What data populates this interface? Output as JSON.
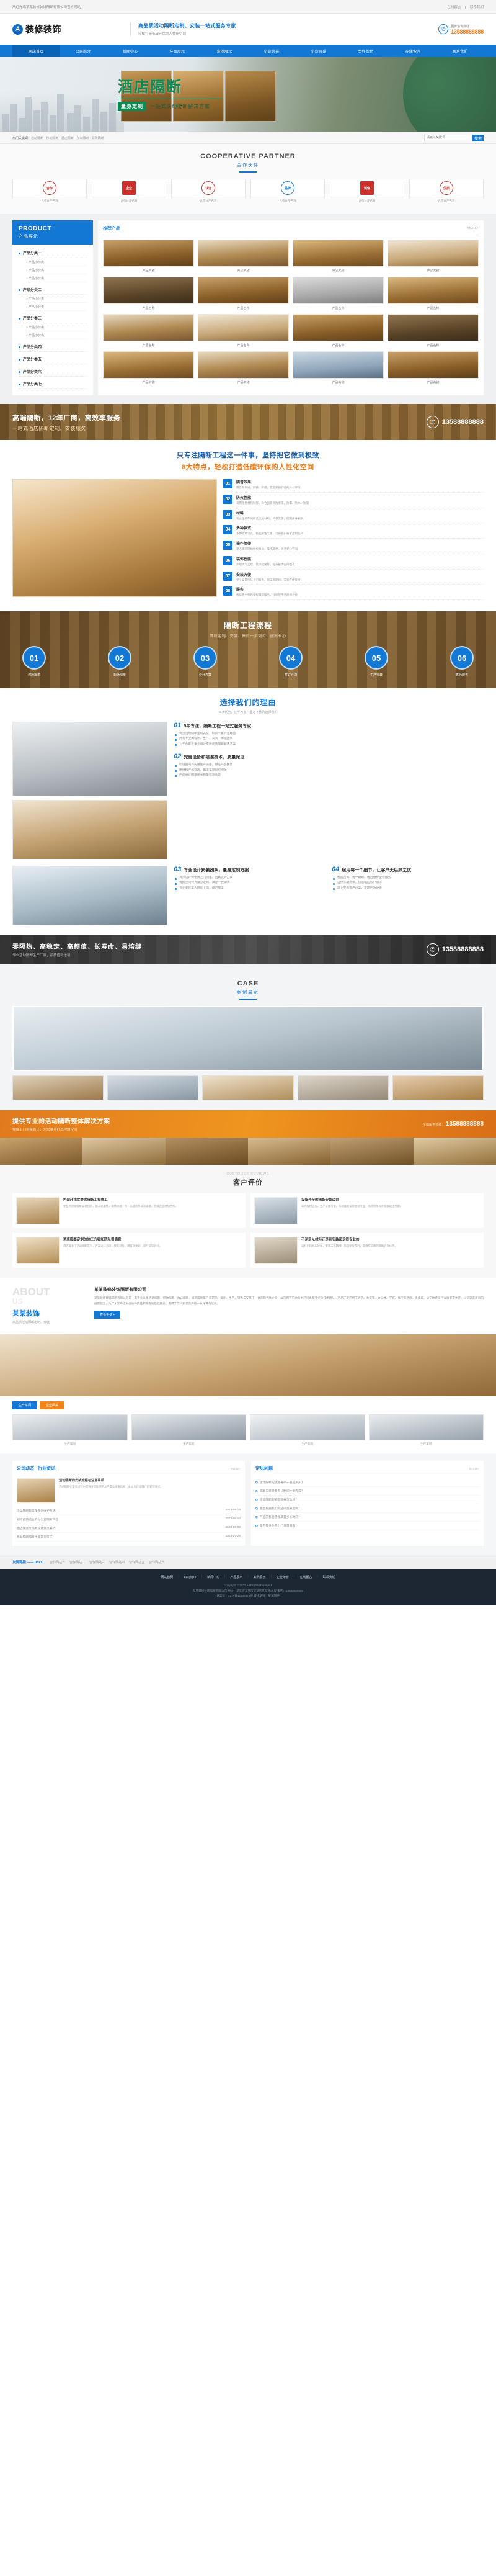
{
  "topbar": {
    "welcome": "欢迎光临某某装修装饰隔断有限公司官方网站!",
    "links": [
      "在线留言",
      "联系我们"
    ]
  },
  "header": {
    "logo_mark": "A",
    "logo_text": "装修装饰",
    "slogan_main": "高品质活动隔断定制、安装一站式服务专家",
    "slogan_sub": "轻松打造低碳环保的人性化空间",
    "hotline_label": "服务咨询热线",
    "hotline_number": "13588888888"
  },
  "nav": {
    "items": [
      {
        "label": "网站首页",
        "active": true
      },
      {
        "label": "公司简介",
        "active": false
      },
      {
        "label": "新闻中心",
        "active": false
      },
      {
        "label": "产品展示",
        "active": false
      },
      {
        "label": "案例展示",
        "active": false
      },
      {
        "label": "企业荣誉",
        "active": false
      },
      {
        "label": "企业风采",
        "active": false
      },
      {
        "label": "合作伙伴",
        "active": false
      },
      {
        "label": "在线留言",
        "active": false
      },
      {
        "label": "联系我们",
        "active": false
      }
    ]
  },
  "banner": {
    "title": "酒店隔断",
    "badge": "量身定制",
    "subtitle": "一站式活动隔断解决方案"
  },
  "searchbar": {
    "keyword_label": "热门关键词：",
    "keywords": "活动隔断 · 移动隔断 · 酒店隔断 · 办公隔断 · 屏风隔断",
    "search_placeholder": "请输入关键词",
    "search_button": "搜索"
  },
  "partners": {
    "title_en": "COOPERATIVE PARTNER",
    "title_cn": "合作伙伴",
    "items": [
      {
        "seal": "合作",
        "caption": "合作伙伴名称"
      },
      {
        "seal": "企业",
        "caption": "合作伙伴名称"
      },
      {
        "seal": "认证",
        "caption": "合作伙伴名称"
      },
      {
        "seal": "品牌",
        "caption": "合作伙伴名称"
      },
      {
        "seal": "诚信",
        "caption": "合作伙伴名称"
      },
      {
        "seal": "优质",
        "caption": "合作伙伴名称"
      }
    ]
  },
  "product": {
    "side_en": "PRODUCT",
    "side_cn": "产品展示",
    "categories": [
      {
        "name": "产品分类一",
        "subs": [
          "产品小分类",
          "产品小分类",
          "产品小分类"
        ]
      },
      {
        "name": "产品分类二",
        "subs": [
          "产品小分类",
          "产品小分类"
        ]
      },
      {
        "name": "产品分类三",
        "subs": [
          "产品小分类",
          "产品小分类"
        ]
      },
      {
        "name": "产品分类四",
        "subs": []
      },
      {
        "name": "产品分类五",
        "subs": []
      },
      {
        "name": "产品分类六",
        "subs": []
      },
      {
        "name": "产品分类七",
        "subs": []
      }
    ],
    "main_title": "推荐产品",
    "more_label": "MORE+",
    "items": [
      {
        "name": "产品名称",
        "style": "ph-wood"
      },
      {
        "name": "产品名称",
        "style": "ph-hall"
      },
      {
        "name": "产品名称",
        "style": "ph-wood2"
      },
      {
        "name": "产品名称",
        "style": "ph-room"
      },
      {
        "name": "产品名称",
        "style": "ph-dark"
      },
      {
        "name": "产品名称",
        "style": "ph-wood"
      },
      {
        "name": "产品名称",
        "style": "ph-gray"
      },
      {
        "name": "产品名称",
        "style": "ph-wood2"
      },
      {
        "name": "产品名称",
        "style": "ph-hall"
      },
      {
        "name": "产品名称",
        "style": "ph-room"
      },
      {
        "name": "产品名称",
        "style": "ph-wood"
      },
      {
        "name": "产品名称",
        "style": "ph-dark"
      },
      {
        "name": "产品名称",
        "style": "ph-wood2"
      },
      {
        "name": "产品名称",
        "style": "ph-hall"
      },
      {
        "name": "产品名称",
        "style": "ph-blue"
      },
      {
        "name": "产品名称",
        "style": "ph-wood"
      }
    ]
  },
  "cta1": {
    "line1": "高端隔断，12年厂商，高效率服务",
    "line2": "一站式酒店隔断定制、安装服务",
    "phone": "13588888888"
  },
  "features": {
    "head1": "只专注隔断工程这一件事，坚持把它做到极致",
    "head2": "8大特点，轻松打造低碳环保的人性化空间",
    "items": [
      {
        "no": "01",
        "title": "隔音效果",
        "desc": "隔音效果好，屏蔽、降噪，营造安静舒适的办公环境"
      },
      {
        "no": "02",
        "title": "防火性能",
        "desc": "采用阻燃材料制作，符合国家消防要求，防霉、防水、防潮"
      },
      {
        "no": "03",
        "title": "材料",
        "desc": "专业生产车间精选优质材料，环保无害，使用寿命长久"
      },
      {
        "no": "04",
        "title": "多种款式",
        "desc": "多种款式可选，板面颜色丰富，可按客户要求定制生产"
      },
      {
        "no": "05",
        "title": "操作简便",
        "desc": "单人即可轻松推拉收放，操作简便，灵活划分空间"
      },
      {
        "no": "06",
        "title": "装饰性强",
        "desc": "外观大气美观，装饰效果好，提升整体空间档次"
      },
      {
        "no": "07",
        "title": "安装方便",
        "desc": "专业安装团队上门服务，施工周期短，安装方便快捷"
      },
      {
        "no": "08",
        "title": "服务",
        "desc": "售前售中售后全程跟踪服务，让您使用无后顾之忧"
      }
    ]
  },
  "process": {
    "title": "隔断工程流程",
    "subtitle": "隔断定制、安装、售后一步到位，据时省心",
    "steps": [
      {
        "no": "01",
        "label": "沟通需求"
      },
      {
        "no": "02",
        "label": "现场测量"
      },
      {
        "no": "03",
        "label": "设计方案"
      },
      {
        "no": "04",
        "label": "签订合同"
      },
      {
        "no": "05",
        "label": "生产安装"
      },
      {
        "no": "06",
        "label": "售后服务"
      }
    ]
  },
  "why": {
    "title": "选择我们的理由",
    "subtitle": "四大优势，让千万客户坚定不移的选择我们",
    "blocks": [
      {
        "num": "01",
        "title": "5年专注，隔断工程一站式服务专家",
        "points": [
          "专注活动隔断定制安装，积累丰富行业经验",
          "拥有专业的设计、生产、安装一体化团队",
          "为千余家企事业单位提供优质隔断解决方案"
        ]
      },
      {
        "num": "02",
        "title": "完善设备和精湛技术，质量保证",
        "points": [
          "引进国内外先进生产设备，保证产品精度",
          "原材料严格筛选，每道工序层层把关",
          "产品通过国家相关质量检测认证"
        ]
      },
      {
        "num": "03",
        "title": "专业设计安装团队，量身定制方案",
        "points": [
          "资深设计师免费上门测量，出具设计方案",
          "根据空间特点量身定制，满足个性需求",
          "专业安装工人持证上岗，规范施工"
        ]
      },
      {
        "num": "04",
        "title": "雇用每一个细节，让客户无后顾之忧",
        "points": [
          "售前咨询、售中跟踪、售后维护全程服务",
          "提供长期质保，快速响应客户需求",
          "建立完善客户档案，定期回访维护"
        ]
      }
    ]
  },
  "cta2": {
    "line1": "零隔热、高稳定、高颜值、长寿命、易培缝",
    "line2": "专业活动隔断生产厂家，品质值得信赖",
    "phone": "13588888888"
  },
  "case": {
    "title_en": "CASE",
    "title_cn": "案例展示"
  },
  "cta3": {
    "line1": "提供专业的活动隔断整体解决方案",
    "line2": "免费上门测量设计，为您量身打造理想空间",
    "tel_label": "全国服务热线：",
    "tel_number": "13588888888"
  },
  "reviews": {
    "title_en": "CUSTOMER REVIEWS",
    "title_cn": "客户评价",
    "items": [
      {
        "title": "内部环境优美的隔断工程施工",
        "desc": "专业的活动隔断安装团队，施工速度快，现场清理干净，成品效果非常满意，后续还会继续合作。"
      },
      {
        "title": "设备齐全的隔断安装公司",
        "desc": "公司规模正规，生产设备齐全，从测量到安装全程专业，隔音效果和外观都超出预期。"
      },
      {
        "title": "酒店隔断定制的施工方案和团队很满意",
        "desc": "酒店宴会厅活动隔断定制，方案设计合理，安装到位，隔音效果好，客户反馈良好。"
      },
      {
        "title": "不论是从材料还是到安装都是很专业的",
        "desc": "选材用料扎实环保，安装工艺精细，售后响应及时，是值得信赖的隔断合作伙伴。"
      }
    ]
  },
  "about": {
    "en1": "ABOUT",
    "en2": "US",
    "cn": "某某装饰",
    "sub": "高品质活动隔断定制、安装",
    "title": "某某装修装饰隔断有限公司",
    "paragraph": "某某装修装饰隔断有限公司是一家专业从事活动隔断、移动隔断、办公隔断、屏风隔断等产品研发、设计、生产、销售与安装于一体的现代化企业。公司拥有先进的生产设备和专业的技术团队，产品广泛应用于酒店、会议室、办公楼、学校、展厅等场所。多年来，公司始终坚持以质量求生存、以信誉求发展的经营理念，为广大客户提供优质的产品和完善的售后服务，赢得了广大新老客户的一致好评与信赖。",
    "more": "查看更多 +"
  },
  "factory": {
    "tabs": [
      "生产车间",
      "企业风采"
    ],
    "items": [
      {
        "caption": "生产车间"
      },
      {
        "caption": "生产车间"
      },
      {
        "caption": "生产车间"
      },
      {
        "caption": "生产车间"
      }
    ]
  },
  "news": {
    "left": {
      "title": "公司动态 · 行业资讯",
      "more": "MORE+",
      "feature_title": "活动隔断的安装流程与注意事项",
      "feature_desc": "活动隔断在安装过程中需要注意轨道的水平度与承重结构，本文为您详细介绍安装要点。",
      "list": [
        {
          "t": "活动隔断日常保养与维护方法",
          "d": "2023-08-15"
        },
        {
          "t": "如何选购适合的办公室隔断产品",
          "d": "2023-08-10"
        },
        {
          "t": "酒店宴会厅隔断设计要点解析",
          "d": "2023-08-02"
        },
        {
          "t": "移动隔断隔音性能提升技巧",
          "d": "2023-07-26"
        }
      ]
    },
    "right": {
      "title": "常见问题",
      "more": "MORE+",
      "list": [
        {
          "q": "Q",
          "t": "活动隔断的使用寿命一般是多久？"
        },
        {
          "q": "Q",
          "t": "隔断安装需要多长时间才能完成？"
        },
        {
          "q": "Q",
          "t": "活动隔断的隔音效果怎么样？"
        },
        {
          "q": "Q",
          "t": "能否根据我们的空间量身定制？"
        },
        {
          "q": "Q",
          "t": "产品的售后质保期是多长时间？"
        },
        {
          "q": "Q",
          "t": "是否提供免费上门测量服务？"
        }
      ]
    }
  },
  "friendlinks": {
    "label": "友情链接 —— links：",
    "items": [
      "合作网站一",
      "合作网站二",
      "合作网站三",
      "合作网站四",
      "合作网站五",
      "合作网站六"
    ]
  },
  "footer": {
    "nav": [
      "网站首页",
      "公司简介",
      "新闻中心",
      "产品展示",
      "案例展示",
      "企业荣誉",
      "在线留言",
      "联系我们"
    ],
    "copyright": "Copyright © 2023 All Rights Reserved.",
    "info": "某某装修装饰隔断有限公司  地址：某某省某某市某某区某某路88号  电话：13588888888",
    "icp": "备案号：XICP备12345678号  技术支持：某某网络"
  },
  "colors": {
    "primary": "#1378d4",
    "orange": "#ef7c19",
    "green": "#0f8a55",
    "dark": "#1c2733"
  }
}
